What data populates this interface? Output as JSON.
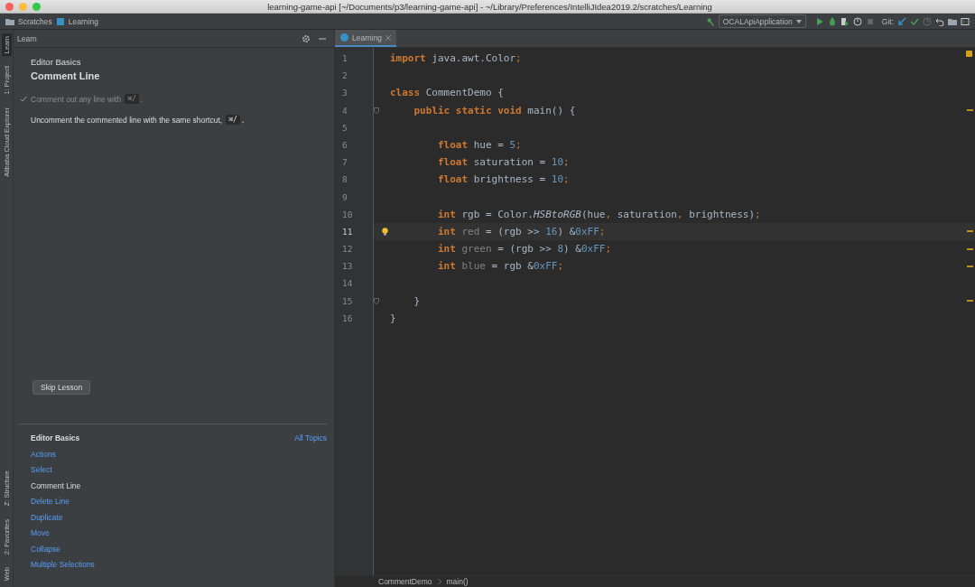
{
  "window": {
    "title": "learning-game-api [~/Documents/p3/learning-game-api] - ~/Library/Preferences/IntelliJIdea2019.2/scratches/Learning"
  },
  "navbar": {
    "breadcrumbs": [
      "Scratches",
      "Learning"
    ],
    "run_config": "OCALApiApplication",
    "git_label": "Git:"
  },
  "tool_stripe": {
    "top": [
      {
        "label": "Learn",
        "selected": true
      },
      {
        "label": "1: Project",
        "selected": false
      },
      {
        "label": "Alibaba Cloud Explorer",
        "selected": false
      }
    ],
    "bottom": [
      {
        "label": "Z: Structure",
        "selected": false
      },
      {
        "label": "2: Favorites",
        "selected": false
      },
      {
        "label": "Web",
        "selected": false
      }
    ]
  },
  "learn_panel": {
    "title": "Learn",
    "module": "Editor Basics",
    "lesson": "Comment Line",
    "tasks": [
      {
        "text": "Comment out any line with",
        "shortcut": "⌘/",
        "tail": ".",
        "done": true
      },
      {
        "text": "Uncomment the commented line with the same shortcut,",
        "shortcut": "⌘/",
        "tail": ".",
        "done": false
      }
    ],
    "skip_button": "Skip Lesson",
    "lessons_heading": "Editor Basics",
    "all_topics": "All Topics",
    "lessons": [
      {
        "label": "Actions",
        "selected": false
      },
      {
        "label": "Select",
        "selected": false
      },
      {
        "label": "Comment Line",
        "selected": true
      },
      {
        "label": "Delete Line",
        "selected": false
      },
      {
        "label": "Duplicate",
        "selected": false
      },
      {
        "label": "Move",
        "selected": false
      },
      {
        "label": "Collapse",
        "selected": false
      },
      {
        "label": "Multiple Selections",
        "selected": false
      }
    ]
  },
  "editor": {
    "tabs": [
      {
        "label": "Learning",
        "selected": true
      }
    ],
    "lines": [
      {
        "number": "1",
        "current": false,
        "bulb": false,
        "fold": false,
        "stripe_mark": false,
        "tokens": [
          {
            "t": "import",
            "kind": "kw"
          },
          {
            "t": " java.awt.Color",
            "kind": "plain"
          },
          {
            "t": ";",
            "kind": "punct"
          }
        ]
      },
      {
        "number": "2",
        "current": false,
        "bulb": false,
        "fold": false,
        "stripe_mark": false
      },
      {
        "number": "3",
        "current": false,
        "bulb": false,
        "fold": false,
        "stripe_mark": false,
        "tokens": [
          {
            "t": "class",
            "kind": "kw"
          },
          {
            "t": " CommentDemo {",
            "kind": "plain"
          }
        ]
      },
      {
        "number": "4",
        "current": false,
        "bulb": false,
        "fold": true,
        "stripe_mark": true,
        "tokens": [
          {
            "t": "    public static void",
            "kind": "kw"
          },
          {
            "t": " main() {",
            "kind": "plain"
          }
        ]
      },
      {
        "number": "5",
        "current": false,
        "bulb": false,
        "fold": false,
        "stripe_mark": false
      },
      {
        "number": "6",
        "current": false,
        "bulb": false,
        "fold": false,
        "stripe_mark": false,
        "tokens": [
          {
            "t": "        float",
            "kind": "kw"
          },
          {
            "t": " hue = ",
            "kind": "plain"
          },
          {
            "t": "5",
            "kind": "num"
          },
          {
            "t": ";",
            "kind": "punct"
          }
        ]
      },
      {
        "number": "7",
        "current": false,
        "bulb": false,
        "fold": false,
        "stripe_mark": false,
        "tokens": [
          {
            "t": "        float",
            "kind": "kw"
          },
          {
            "t": " saturation = ",
            "kind": "plain"
          },
          {
            "t": "10",
            "kind": "num"
          },
          {
            "t": ";",
            "kind": "punct"
          }
        ]
      },
      {
        "number": "8",
        "current": false,
        "bulb": false,
        "fold": false,
        "stripe_mark": false,
        "tokens": [
          {
            "t": "        float",
            "kind": "kw"
          },
          {
            "t": " brightness = ",
            "kind": "plain"
          },
          {
            "t": "10",
            "kind": "num"
          },
          {
            "t": ";",
            "kind": "punct"
          }
        ]
      },
      {
        "number": "9",
        "current": false,
        "bulb": false,
        "fold": false,
        "stripe_mark": false
      },
      {
        "number": "10",
        "current": false,
        "bulb": false,
        "fold": false,
        "stripe_mark": false,
        "tokens": [
          {
            "t": "        int",
            "kind": "kw"
          },
          {
            "t": " rgb = Color.",
            "kind": "plain"
          },
          {
            "t": "HSBtoRGB",
            "kind": "italic"
          },
          {
            "t": "(hue",
            "kind": "plain"
          },
          {
            "t": ",",
            "kind": "punct"
          },
          {
            "t": " saturation",
            "kind": "plain"
          },
          {
            "t": ",",
            "kind": "punct"
          },
          {
            "t": " brightness)",
            "kind": "plain"
          },
          {
            "t": ";",
            "kind": "punct"
          }
        ]
      },
      {
        "number": "11",
        "current": true,
        "bulb": true,
        "fold": false,
        "stripe_mark": true,
        "tokens": [
          {
            "t": "        int",
            "kind": "kw"
          },
          {
            "t": " red",
            "kind": "unused"
          },
          {
            "t": " = (rgb >> ",
            "kind": "plain"
          },
          {
            "t": "16",
            "kind": "num"
          },
          {
            "t": ") &",
            "kind": "plain"
          },
          {
            "t": "0xFF",
            "kind": "num"
          },
          {
            "t": ";",
            "kind": "punct"
          }
        ]
      },
      {
        "number": "12",
        "current": false,
        "bulb": false,
        "fold": false,
        "stripe_mark": true,
        "tokens": [
          {
            "t": "        int",
            "kind": "kw"
          },
          {
            "t": " green",
            "kind": "unused"
          },
          {
            "t": " = (rgb >> ",
            "kind": "plain"
          },
          {
            "t": "8",
            "kind": "num"
          },
          {
            "t": ") &",
            "kind": "plain"
          },
          {
            "t": "0xFF",
            "kind": "num"
          },
          {
            "t": ";",
            "kind": "punct"
          }
        ]
      },
      {
        "number": "13",
        "current": false,
        "bulb": false,
        "fold": false,
        "stripe_mark": true,
        "tokens": [
          {
            "t": "        int",
            "kind": "kw"
          },
          {
            "t": " blue",
            "kind": "unused"
          },
          {
            "t": " = rgb &",
            "kind": "plain"
          },
          {
            "t": "0xFF",
            "kind": "num"
          },
          {
            "t": ";",
            "kind": "punct"
          }
        ]
      },
      {
        "number": "14",
        "current": false,
        "bulb": false,
        "fold": false,
        "stripe_mark": false
      },
      {
        "number": "15",
        "current": false,
        "bulb": false,
        "fold": true,
        "stripe_mark": true,
        "tokens": [
          {
            "t": "    }",
            "kind": "plain"
          }
        ]
      },
      {
        "number": "16",
        "current": false,
        "bulb": false,
        "fold": false,
        "stripe_mark": false,
        "tokens": [
          {
            "t": "}",
            "kind": "plain"
          }
        ]
      }
    ],
    "breadcrumbs": [
      "CommentDemo",
      "main()"
    ]
  }
}
